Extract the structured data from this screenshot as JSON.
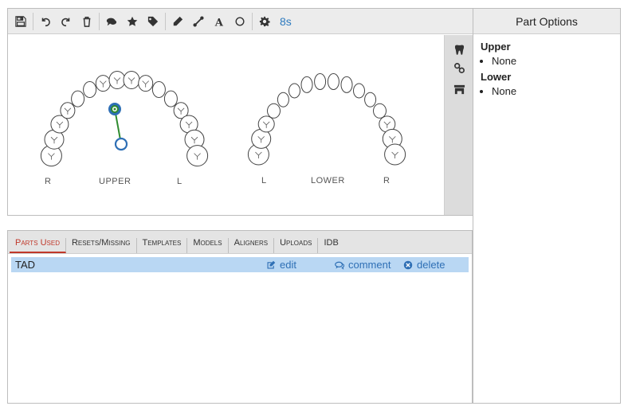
{
  "toolbar": {
    "timer": "8s",
    "tools": [
      "save-icon",
      "undo-icon",
      "redo-icon",
      "trash-icon",
      "comments-icon",
      "star-icon",
      "tag-icon",
      "pencil-icon",
      "line-icon",
      "text-icon",
      "circle-icon",
      "gear-icon"
    ]
  },
  "chart_labels": {
    "upper": {
      "left": "R",
      "center": "UPPER",
      "right": "L"
    },
    "lower": {
      "left": "L",
      "center": "LOWER",
      "right": "R"
    }
  },
  "tabs": [
    {
      "label": "Parts Used",
      "active": true
    },
    {
      "label": "Resets/Missing"
    },
    {
      "label": "Templates"
    },
    {
      "label": "Models"
    },
    {
      "label": "Aligners"
    },
    {
      "label": "Uploads"
    },
    {
      "label": "IDB"
    }
  ],
  "parts_row": {
    "name": "TAD",
    "edit": "edit",
    "comment": "comment",
    "delete": "delete"
  },
  "options": {
    "title": "Part Options",
    "upper_title": "Upper",
    "upper_items": [
      "None"
    ],
    "lower_title": "Lower",
    "lower_items": [
      "None"
    ]
  },
  "colors": {
    "accent_link": "#2e6fb5",
    "active_tab": "#c0392b",
    "row_highlight": "#b9d7f3",
    "tad_marker": "#2e6fb5",
    "tad_line": "#2e8b2e"
  }
}
